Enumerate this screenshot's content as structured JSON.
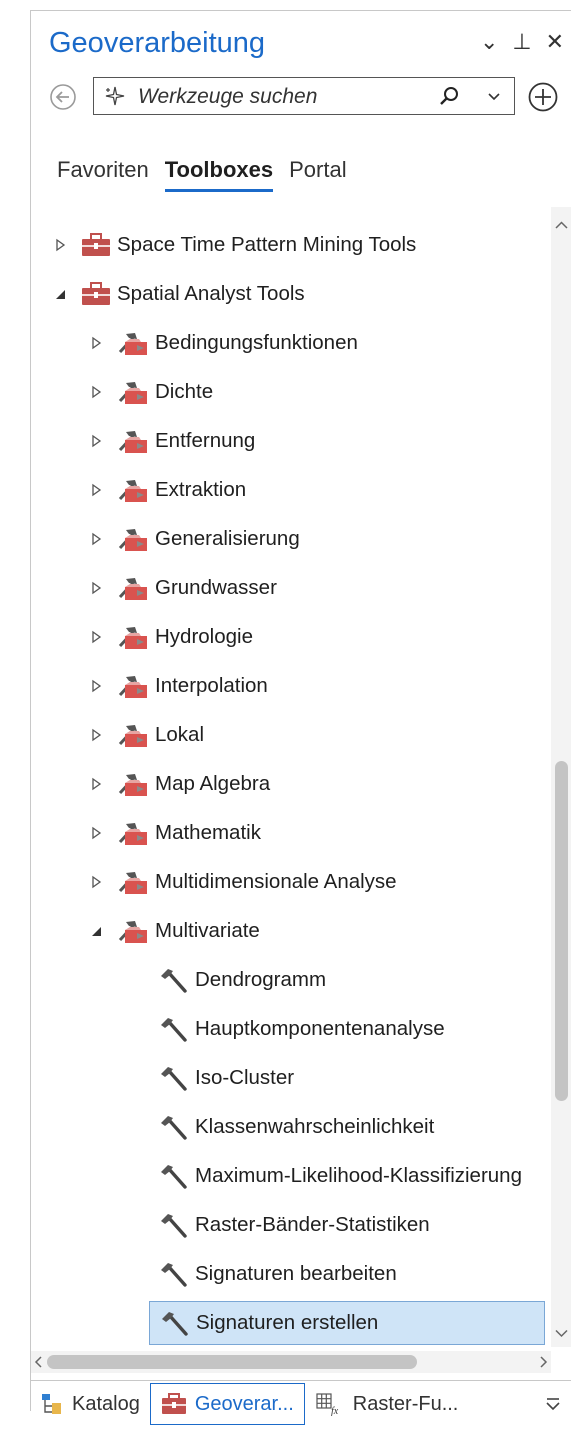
{
  "panel": {
    "title": "Geoverarbeitung",
    "controls": {
      "menu_icon": "chevron-down-icon",
      "pin_icon": "pin-icon",
      "close_icon": "close-icon",
      "menu": "⌄",
      "pin": "⊥",
      "close": "✕"
    }
  },
  "search": {
    "placeholder": "Werkzeuge suchen"
  },
  "tabs": [
    "Favoriten",
    "Toolboxes",
    "Portal"
  ],
  "active_tab": "Toolboxes",
  "tree": [
    {
      "label": "Space Time Pattern Mining Tools",
      "level": 0,
      "expand": "collapsed",
      "icon": "toolbox-icon"
    },
    {
      "label": "Spatial Analyst Tools",
      "level": 0,
      "expand": "expanded",
      "icon": "toolbox-icon"
    },
    {
      "label": "Bedingungsfunktionen",
      "level": 1,
      "expand": "collapsed",
      "icon": "toolset-icon"
    },
    {
      "label": "Dichte",
      "level": 1,
      "expand": "collapsed",
      "icon": "toolset-icon"
    },
    {
      "label": "Entfernung",
      "level": 1,
      "expand": "collapsed",
      "icon": "toolset-icon"
    },
    {
      "label": "Extraktion",
      "level": 1,
      "expand": "collapsed",
      "icon": "toolset-icon"
    },
    {
      "label": "Generalisierung",
      "level": 1,
      "expand": "collapsed",
      "icon": "toolset-icon"
    },
    {
      "label": "Grundwasser",
      "level": 1,
      "expand": "collapsed",
      "icon": "toolset-icon"
    },
    {
      "label": "Hydrologie",
      "level": 1,
      "expand": "collapsed",
      "icon": "toolset-icon"
    },
    {
      "label": "Interpolation",
      "level": 1,
      "expand": "collapsed",
      "icon": "toolset-icon"
    },
    {
      "label": "Lokal",
      "level": 1,
      "expand": "collapsed",
      "icon": "toolset-icon"
    },
    {
      "label": "Map Algebra",
      "level": 1,
      "expand": "collapsed",
      "icon": "toolset-icon"
    },
    {
      "label": "Mathematik",
      "level": 1,
      "expand": "collapsed",
      "icon": "toolset-icon"
    },
    {
      "label": "Multidimensionale Analyse",
      "level": 1,
      "expand": "collapsed",
      "icon": "toolset-icon"
    },
    {
      "label": "Multivariate",
      "level": 1,
      "expand": "expanded",
      "icon": "toolset-icon"
    },
    {
      "label": "Dendrogramm",
      "level": 2,
      "expand": "none",
      "icon": "hammer-icon"
    },
    {
      "label": "Hauptkomponentenanalyse",
      "level": 2,
      "expand": "none",
      "icon": "hammer-icon"
    },
    {
      "label": "Iso-Cluster",
      "level": 2,
      "expand": "none",
      "icon": "hammer-icon"
    },
    {
      "label": "Klassenwahrscheinlichkeit",
      "level": 2,
      "expand": "none",
      "icon": "hammer-icon"
    },
    {
      "label": "Maximum-Likelihood-Klassifizierung",
      "level": 2,
      "expand": "none",
      "icon": "hammer-icon"
    },
    {
      "label": "Raster-Bänder-Statistiken",
      "level": 2,
      "expand": "none",
      "icon": "hammer-icon"
    },
    {
      "label": "Signaturen bearbeiten",
      "level": 2,
      "expand": "none",
      "icon": "hammer-icon"
    },
    {
      "label": "Signaturen erstellen",
      "level": 2,
      "expand": "none",
      "icon": "hammer-icon",
      "selected": true
    }
  ],
  "bottom_tabs": [
    {
      "label": "Katalog",
      "icon": "catalog-icon"
    },
    {
      "label": "Geoverar...",
      "icon": "toolbox-icon",
      "active": true
    },
    {
      "label": "Raster-Fu...",
      "icon": "raster-function-icon"
    }
  ],
  "colors": {
    "accent": "#1b6ac9",
    "toolbox": "#c0504d",
    "selection": "#cfe4f7"
  }
}
